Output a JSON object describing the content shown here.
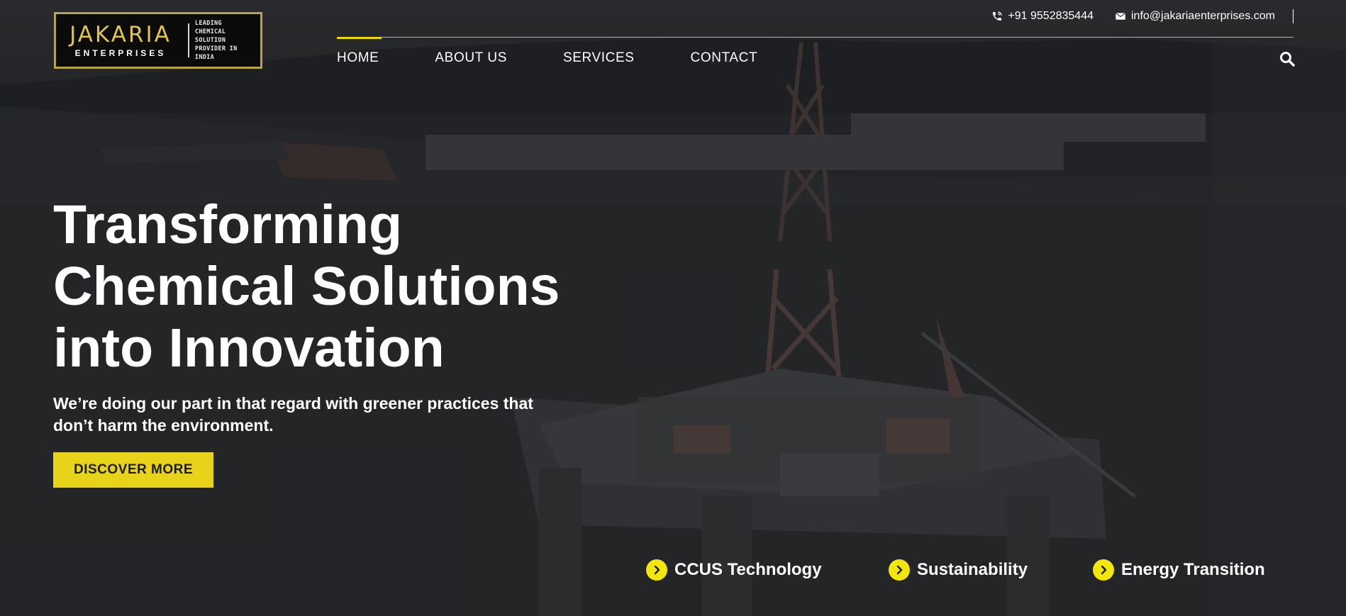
{
  "brand": {
    "name": "JAKARIA",
    "sub": "ENTERPRISES",
    "tagline": [
      "LEADING",
      "CHEMICAL SOLUTION",
      "PROVIDER IN INDIA"
    ]
  },
  "contact": {
    "phone": "+91 9552835444",
    "email": "info@jakariaenterprises.com"
  },
  "nav": {
    "items": [
      "HOME",
      "ABOUT US",
      "SERVICES",
      "CONTACT"
    ],
    "active": "HOME"
  },
  "hero": {
    "title_lines": [
      "Transforming",
      "Chemical Solutions",
      "into Innovation"
    ],
    "subtitle_lines": [
      "We’re doing our part in that regard with greener practices that",
      "don’t harm the environment."
    ],
    "cta_label": "DISCOVER MORE"
  },
  "features": [
    "CCUS Technology",
    "Sustainability",
    "Energy Transition"
  ],
  "icons": {
    "phone": "phone-icon",
    "email": "envelope-icon",
    "search": "search-icon",
    "feature_bullet": "chevron-right-circle-icon"
  },
  "colors": {
    "accent": "#e7d41a",
    "logo_gold": "#e2c446",
    "text": "#ffffff",
    "button_text": "#1d1d1d"
  }
}
